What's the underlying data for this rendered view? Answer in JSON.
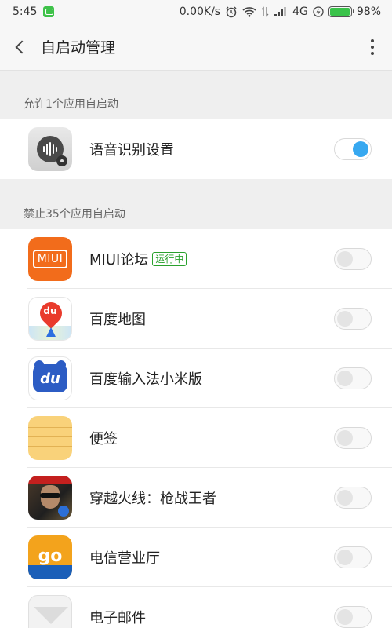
{
  "status_bar": {
    "time": "5:45",
    "net_speed": "0.00K/s",
    "network_type": "4G",
    "battery_percent": "98%",
    "battery_level": 0.98,
    "icons": [
      "wechat-notification-icon",
      "alarm-icon",
      "wifi-icon",
      "signal-icon",
      "charging-icon",
      "battery-icon"
    ]
  },
  "title_bar": {
    "title": "自启动管理",
    "back_icon": "chevron-left-icon",
    "more_icon": "more-vertical-icon"
  },
  "sections": [
    {
      "header": "允许1个应用自启动",
      "apps": [
        {
          "name": "语音识别设置",
          "icon": "voice-recognition-settings-icon",
          "enabled": true
        }
      ]
    },
    {
      "header": "禁止35个应用自启动",
      "apps": [
        {
          "name": "MIUI论坛",
          "icon": "miui-forum-icon",
          "badge": "运行中",
          "enabled": false
        },
        {
          "name": "百度地图",
          "icon": "baidu-map-icon",
          "enabled": false
        },
        {
          "name": "百度输入法小米版",
          "icon": "baidu-input-icon",
          "enabled": false
        },
        {
          "name": "便签",
          "icon": "notes-icon",
          "enabled": false
        },
        {
          "name": "穿越火线：枪战王者",
          "icon": "crossfire-game-icon",
          "enabled": false
        },
        {
          "name": "电信营业厅",
          "icon": "telecom-hall-icon",
          "enabled": false
        },
        {
          "name": "电子邮件",
          "icon": "email-icon",
          "enabled": false
        }
      ]
    }
  ],
  "colors": {
    "toggle_on": "#37a8f0",
    "badge_green": "#2aa12d",
    "miui_orange": "#f26c1b"
  }
}
